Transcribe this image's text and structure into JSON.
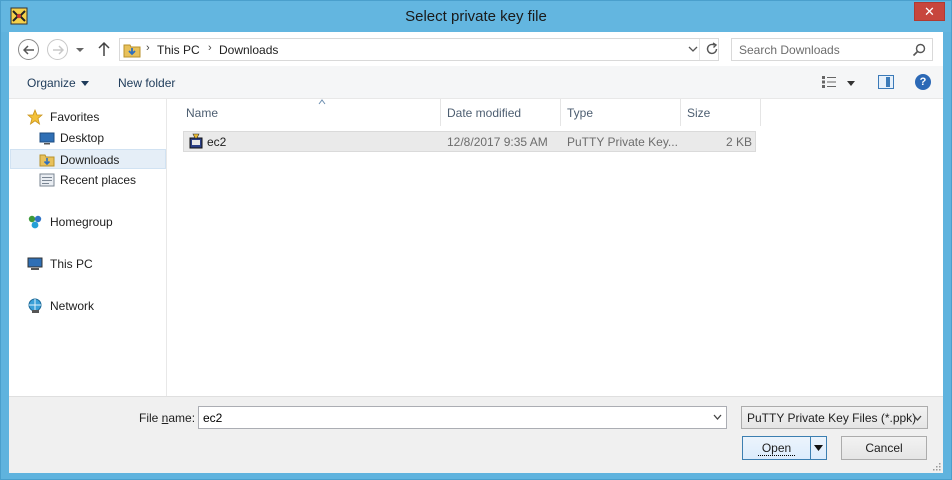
{
  "window": {
    "title": "Select private key file",
    "close_glyph": "✕"
  },
  "address": {
    "crumbs": [
      "This PC",
      "Downloads"
    ],
    "search_placeholder": "Search Downloads"
  },
  "toolbar": {
    "organize": "Organize",
    "new_folder": "New folder",
    "help_glyph": "?"
  },
  "nav": {
    "items": [
      {
        "label": "Favorites",
        "icon": "star-icon"
      },
      {
        "label": "Desktop",
        "icon": "desktop-icon"
      },
      {
        "label": "Downloads",
        "icon": "downloads-folder-icon",
        "selected": true
      },
      {
        "label": "Recent places",
        "icon": "recent-places-icon"
      },
      {
        "label": "Homegroup",
        "icon": "homegroup-icon"
      },
      {
        "label": "This PC",
        "icon": "computer-icon"
      },
      {
        "label": "Network",
        "icon": "network-icon"
      }
    ]
  },
  "files": {
    "columns": [
      "Name",
      "Date modified",
      "Type",
      "Size"
    ],
    "rows": [
      {
        "name": "ec2",
        "date": "12/8/2017 9:35 AM",
        "type": "PuTTY Private Key...",
        "size": "2 KB",
        "icon": "putty-key-icon"
      }
    ]
  },
  "bottom": {
    "file_name_label_pre": "File ",
    "file_name_label_u": "n",
    "file_name_label_post": "ame:",
    "file_name_value": "ec2",
    "filter": "PuTTY Private Key Files (*.ppk)",
    "open_label": "Open",
    "cancel_label": "Cancel"
  },
  "colors": {
    "titlebar": "#63b6e0",
    "close": "#c7463d",
    "selection": "#e5eef7"
  }
}
